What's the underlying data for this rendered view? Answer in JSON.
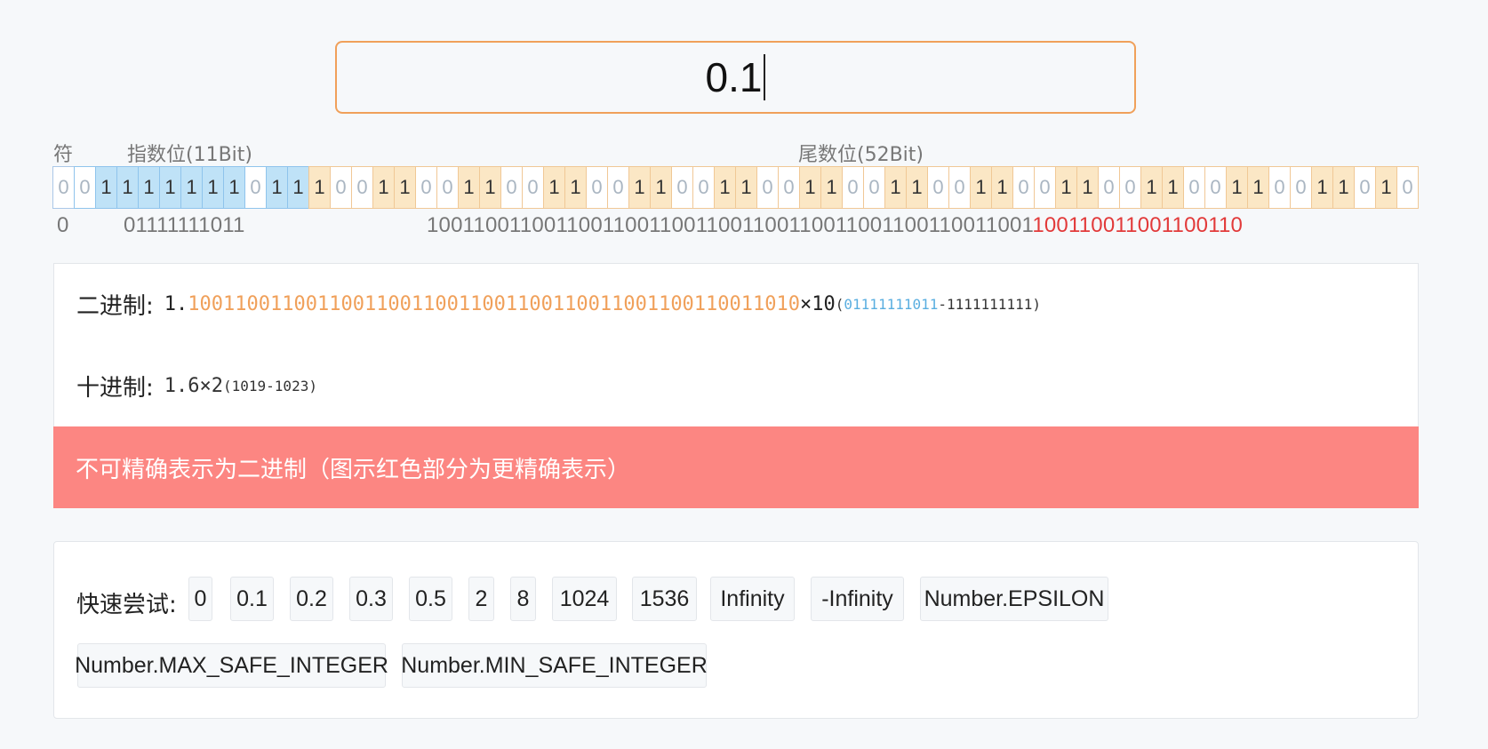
{
  "input": {
    "value": "0.1"
  },
  "labels": {
    "sign": "符",
    "exponent": "指数位(11Bit)",
    "mantissa": "尾数位(52Bit)"
  },
  "bits": "0011111110111001100110011001100110011001100110011001100110011010",
  "bit_strings": {
    "sign": "0",
    "exponent": "01111111011",
    "mantissa_main": "1001100110011001100110011001100110011001100110011001",
    "mantissa_extra": "10011001100110011 0"
  },
  "binary": {
    "label": "二进制:",
    "lead": "1.",
    "fraction": "1001100110011001100110011001100110011001100110011010",
    "times": "×10",
    "exp_a": "01111111011",
    "exp_b": "-1111111111",
    "open": "(",
    "close": ")"
  },
  "decimal": {
    "label": "十进制:",
    "value": "1.6×2",
    "exp": "(1019-1023)"
  },
  "warning": "不可精确表示为二进制（图示红色部分为更精确表示）",
  "quick": {
    "label": "快速尝试:",
    "items": [
      "0",
      "0.1",
      "0.2",
      "0.3",
      "0.5",
      "2",
      "8",
      "1024",
      "1536",
      "Infinity",
      "-Infinity",
      "Number.EPSILON",
      "Number.MAX_SAFE_INTEGER",
      "Number.MIN_SAFE_INTEGER"
    ]
  }
}
